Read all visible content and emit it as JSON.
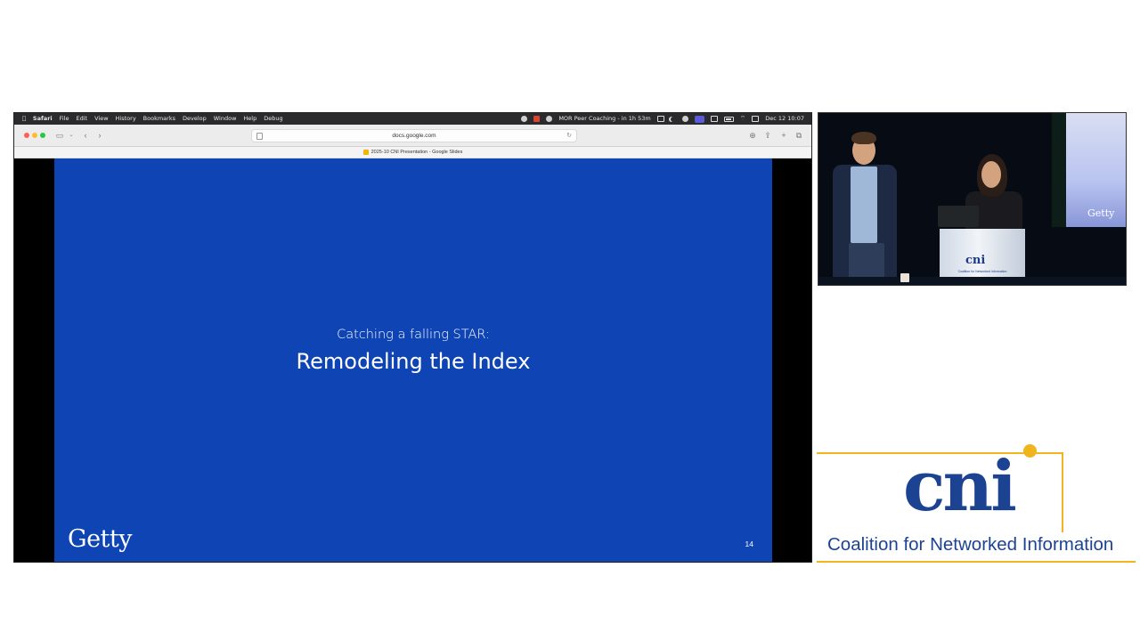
{
  "menubar": {
    "apple": "",
    "app": "Safari",
    "items": [
      "File",
      "Edit",
      "View",
      "History",
      "Bookmarks",
      "Develop",
      "Window",
      "Help",
      "Debug"
    ],
    "meeting": "MOR Peer Coaching - in 1h 53m",
    "datetime": "Dec 12  10:07"
  },
  "browser": {
    "url": "docs.google.com",
    "tab_title": "2025-10 CNI Presentation - Google Slides"
  },
  "slide": {
    "subtitle": "Catching a falling STAR:",
    "title": "Remodeling the Index",
    "logo": "Getty",
    "number": "14",
    "nav_page": "14",
    "background": "#0f44b5"
  },
  "camera": {
    "screen_logo": "Getty",
    "podium_logo": "cni",
    "podium_subtitle": "Coalition for Networked Information"
  },
  "sponsor": {
    "wordmark": "cni",
    "name": "Coalition for Networked Information",
    "brand_color": "#1c4392",
    "accent_color": "#f0b41c"
  }
}
